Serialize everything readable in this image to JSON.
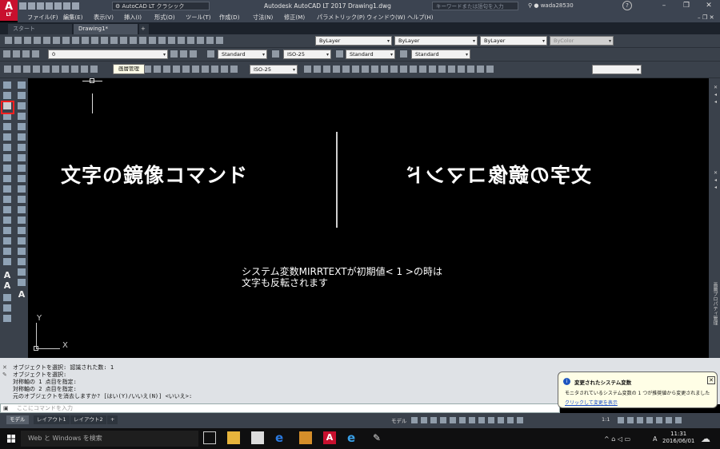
{
  "app": {
    "logo_text": "A",
    "logo_sub": "LT",
    "workspace": "AutoCAD LT クラシック",
    "window_title": "Autodesk AutoCAD LT 2017   Drawing1.dwg",
    "search_placeholder": "キーワードまたは語句を入力",
    "username": "wada28530",
    "help": "?"
  },
  "menu": [
    "ファイル(F)",
    "編集(E)",
    "表示(V)",
    "挿入(I)",
    "形式(O)",
    "ツール(T)",
    "作成(D)",
    "寸法(N)",
    "修正(M)",
    "パラメトリック(P)",
    "ウィンドウ(W)",
    "ヘルプ(H)"
  ],
  "tabs": {
    "start": "スタート",
    "drawing": "Drawing1*",
    "new": "+"
  },
  "properties": {
    "color": "ByLayer",
    "linetype": "ByLayer",
    "lineweight": "ByLayer",
    "plotstyle": "ByColor"
  },
  "layer": {
    "current": "0"
  },
  "styles": {
    "text": "Standard",
    "dim": "ISO-25",
    "table": "Standard",
    "mleader": "Standard",
    "dim2": "ISO-25"
  },
  "tooltip": "画層管理",
  "drawing": {
    "text_left": "文字の鏡像コマンド",
    "text_right": "文字の鏡像コマンド",
    "note_line1": "システム変数MIRRTEXTが初期値<  1  >の時は",
    "note_line2": "文字も反転されます",
    "ucs_y": "Y",
    "ucs_x": "X"
  },
  "left_toolbar": {
    "text_tool_1": "A",
    "text_tool_2": "A"
  },
  "command": {
    "history": [
      "オブジェクトを選択: 認識された数: 1",
      "オブジェクトを選択:",
      "対称軸の 1 点目を指定:",
      "対称軸の 2 点目を指定:",
      "元のオブジェクトを消去しますか? [はい(Y)/いいえ(N)] <いいえ>:"
    ],
    "placeholder": "ここにコマンドを入力"
  },
  "notification": {
    "title": "変更されたシステム変数",
    "body": "モニタされているシステム変数の 1 つが推奨値から変更されました",
    "link": "クリックして変更を表示"
  },
  "layout_tabs": [
    "モデル",
    "レイアウト1",
    "レイアウト2",
    "+"
  ],
  "status": {
    "model": "モデル",
    "scale": "1:1"
  },
  "taskbar": {
    "search": "Web と Windows を検索",
    "time": "11:31",
    "date": "2016/06/01",
    "ime": "A"
  }
}
